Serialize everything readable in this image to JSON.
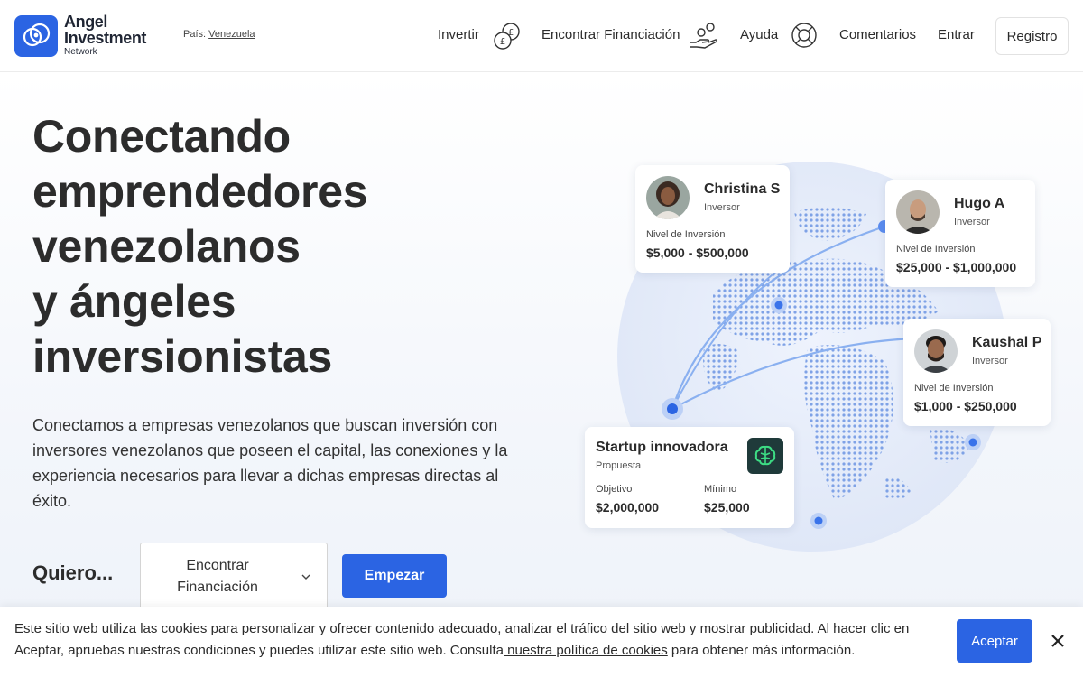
{
  "header": {
    "logo": {
      "line1": "Angel",
      "line2": "Investment",
      "line3": "Network"
    },
    "country_label": "País:",
    "country_value": "Venezuela",
    "nav": [
      {
        "label": "Invertir",
        "icon": "coins-icon"
      },
      {
        "label": "Encontrar Financiación",
        "icon": "hand-coins-icon"
      },
      {
        "label": "Ayuda",
        "icon": "lifebuoy-icon"
      },
      {
        "label": "Comentarios"
      },
      {
        "label": "Entrar"
      }
    ],
    "register_label": "Registro"
  },
  "hero": {
    "title_lines": [
      "Conectando",
      "emprendedores",
      "venezolanos",
      "y ángeles",
      "inversionistas"
    ],
    "description": "Conectamos a empresas venezolanos que buscan inversión con inversores venezolanos que poseen el capital, las conexiones y la experiencia necesarios para llevar a dichas empresas directas al éxito.",
    "quiero_label": "Quiero...",
    "select_value": "Encontrar Financiación",
    "start_label": "Empezar"
  },
  "cards": {
    "christina": {
      "name": "Christina S",
      "role": "Inversor",
      "level_label": "Nivel de Inversión",
      "level_value": "$5,000 - $500,000"
    },
    "hugo": {
      "name": "Hugo A",
      "role": "Inversor",
      "level_label": "Nivel de Inversión",
      "level_value": "$25,000 - $1,000,000"
    },
    "kaushal": {
      "name": "Kaushal P",
      "role": "Inversor",
      "level_label": "Nivel de Inversión",
      "level_value": "$1,000 - $250,000"
    },
    "startup": {
      "name": "Startup innovadora",
      "role": "Propuesta",
      "goal_label": "Objetivo",
      "goal_value": "$2,000,000",
      "min_label": "Mínimo",
      "min_value": "$25,000",
      "icon": "brain-icon"
    }
  },
  "cookie": {
    "text_before": "Este sitio web utiliza las cookies para personalizar y ofrecer contenido adecuado, analizar el tráfico del sitio web y mostrar publicidad. Al hacer clic en Aceptar, apruebas nuestras condiciones y puedes utilizar este sitio web. Consulta",
    "link": " nuestra política de cookies",
    "text_after": " para obtener más información.",
    "accept_label": "Aceptar"
  },
  "colors": {
    "brand": "#2b64e3",
    "text": "#2b2b2b",
    "startup_icon_bg": "#1f3a3a",
    "startup_icon_fg": "#3ddc84"
  }
}
